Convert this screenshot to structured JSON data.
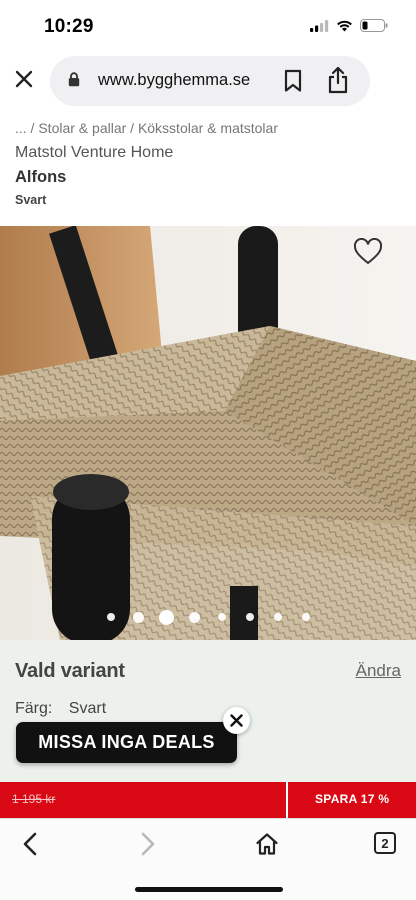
{
  "status": {
    "time": "10:29",
    "icons": [
      "cellular-signal-icon",
      "wifi-icon",
      "battery-icon"
    ]
  },
  "browser": {
    "url": "www.bygghemma.se",
    "close_icon": "close-icon",
    "lock_icon": "lock-icon",
    "bookmark_icon": "bookmark-icon",
    "share_icon": "share-icon"
  },
  "product": {
    "breadcrumb": "... / Stolar & pallar / Köksstolar & matstolar",
    "brand": "Matstol Venture Home",
    "name": "Alfons",
    "color": "Svart",
    "favorite_icon": "heart-icon",
    "carousel": {
      "total": 8,
      "active": 3
    }
  },
  "variant": {
    "title": "Vald variant",
    "change_label": "Ändra",
    "color_label": "Färg:",
    "color_value": "Svart"
  },
  "promo": {
    "banner_text": "MISSA INGA DEALS",
    "close_icon": "close-icon"
  },
  "pricing": {
    "old_price": "1 195 kr",
    "save_label": "SPARA 17 %"
  },
  "toolbar": {
    "back_icon": "chevron-left-icon",
    "forward_icon": "chevron-right-icon",
    "home_icon": "home-icon",
    "tab_count": "2"
  },
  "colors": {
    "sale_red": "#d80914",
    "variant_bg": "#edf1ec",
    "banner_black": "#111111"
  }
}
